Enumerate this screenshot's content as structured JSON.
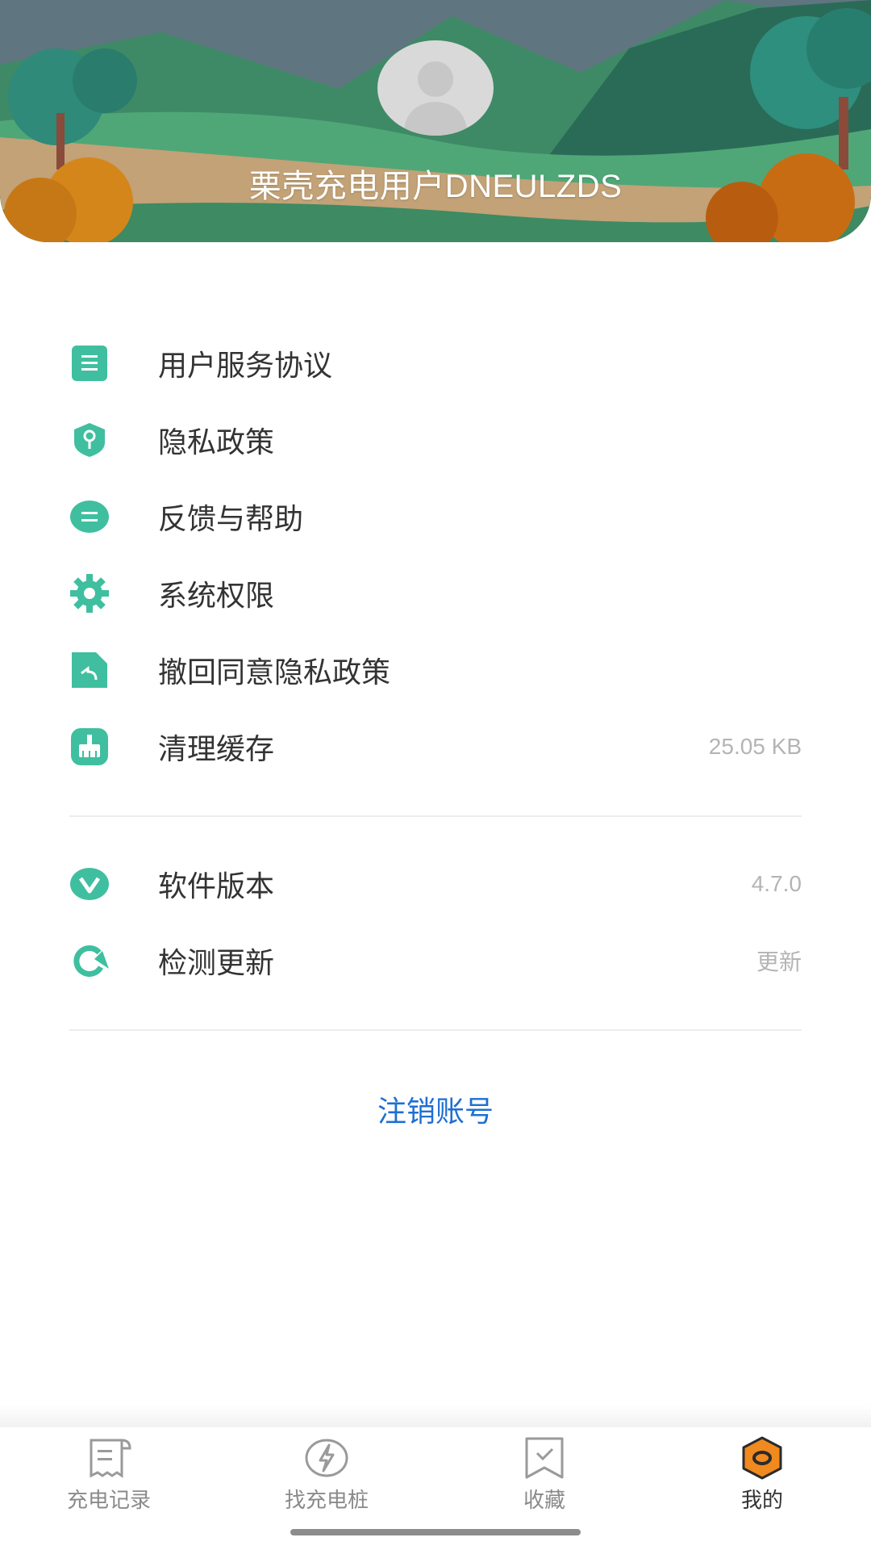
{
  "header": {
    "username": "栗壳充电用户DNEULZDS"
  },
  "menu": {
    "items": [
      {
        "label": "用户服务协议",
        "icon": "document-icon"
      },
      {
        "label": "隐私政策",
        "icon": "shield-key-icon"
      },
      {
        "label": "反馈与帮助",
        "icon": "chat-bubble-icon"
      },
      {
        "label": "系统权限",
        "icon": "gear-icon"
      },
      {
        "label": "撤回同意隐私政策",
        "icon": "revoke-file-icon"
      },
      {
        "label": "清理缓存",
        "icon": "broom-icon",
        "value": "25.05 KB"
      }
    ],
    "about": [
      {
        "label": "软件版本",
        "icon": "version-v-icon",
        "value": "4.7.0"
      },
      {
        "label": "检测更新",
        "icon": "refresh-icon",
        "value": "更新"
      }
    ],
    "logout_label": "注销账号"
  },
  "tabbar": {
    "tabs": [
      {
        "label": "充电记录",
        "icon": "receipt-icon"
      },
      {
        "label": "找充电桩",
        "icon": "lightning-icon"
      },
      {
        "label": "收藏",
        "icon": "bookmark-icon"
      },
      {
        "label": "我的",
        "icon": "hexagon-profile-icon",
        "active": true
      }
    ]
  },
  "colors": {
    "accent_green": "#3fbf9f",
    "link_blue": "#1e6fd2",
    "active_tab_orange": "#f08a1e"
  }
}
